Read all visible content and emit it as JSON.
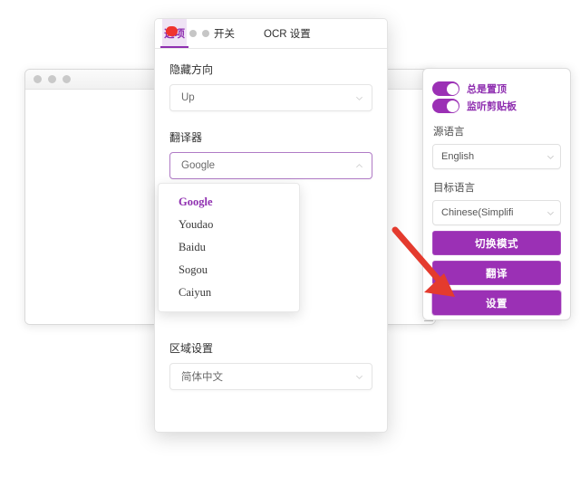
{
  "theme": {
    "accent_purple": "#9b30b5",
    "accent_purple_text": "#8f2fb0",
    "badge_red": "#f0332e",
    "arrow_red": "#e43b2e",
    "toggle_on": "#9b30b5"
  },
  "background_window": {
    "name": "main-translator-window",
    "traffic_lights": [
      "close",
      "minimize",
      "maximize"
    ],
    "textarea_value": "",
    "textarea_placeholder": ""
  },
  "floating_panel": {
    "toggles": [
      {
        "label": "总是置顶",
        "state": "on"
      },
      {
        "label": "监听剪贴板",
        "state": "on"
      }
    ],
    "source_language": {
      "label": "源语言",
      "value": "English"
    },
    "target_language": {
      "label": "目标语言",
      "value": "Chinese(Simplifi"
    },
    "buttons": [
      {
        "label": "切换模式",
        "name": "switch-mode-button"
      },
      {
        "label": "翻译",
        "name": "translate-button"
      },
      {
        "label": "设置",
        "name": "settings-button"
      }
    ]
  },
  "settings_panel": {
    "tabs": [
      {
        "label": "选项",
        "active": true,
        "badge": true
      },
      {
        "label": "开关",
        "active": false
      },
      {
        "label": "OCR 设置",
        "active": false
      }
    ],
    "fields": {
      "hide_direction": {
        "label": "隐藏方向",
        "value": "Up"
      },
      "translator": {
        "label": "翻译器",
        "value": "Google",
        "expanded": true,
        "options": [
          {
            "label": "Google",
            "selected": true
          },
          {
            "label": "Youdao",
            "selected": false
          },
          {
            "label": "Baidu",
            "selected": false
          },
          {
            "label": "Sogou",
            "selected": false
          },
          {
            "label": "Caiyun",
            "selected": false
          }
        ]
      },
      "locale": {
        "label": "区域设置",
        "value": "简体中文"
      }
    }
  },
  "annotation": {
    "arrow": "red-arrow-pointing-to-settings-button"
  }
}
